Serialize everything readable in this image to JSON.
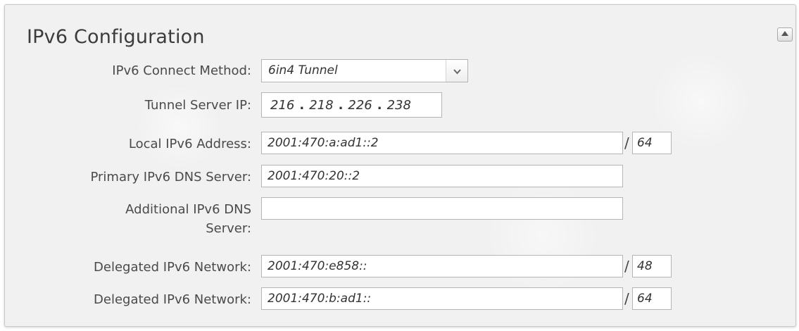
{
  "panel": {
    "title": "IPv6 Configuration"
  },
  "fields": {
    "connect_method": {
      "label": "IPv6 Connect Method:",
      "value": "6in4 Tunnel"
    },
    "tunnel_server": {
      "label": "Tunnel Server IP:",
      "octets": [
        "216",
        "218",
        "226",
        "238"
      ],
      "separator": "."
    },
    "local_address": {
      "label": "Local IPv6 Address:",
      "value": "2001:470:a:ad1::2",
      "prefix": "64"
    },
    "primary_dns": {
      "label": "Primary IPv6 DNS Server:",
      "value": "2001:470:20::2"
    },
    "additional_dns": {
      "label_line1": "Additional IPv6 DNS",
      "label_line2": "Server:",
      "value": ""
    },
    "delegated_1": {
      "label": "Delegated IPv6 Network:",
      "value": "2001:470:e858::",
      "prefix": "48"
    },
    "delegated_2": {
      "label": "Delegated IPv6 Network:",
      "value": "2001:470:b:ad1::",
      "prefix": "64"
    },
    "prefix_separator": "/"
  },
  "icons": {
    "collapse": "collapse-up-icon",
    "dropdown": "chevron-down-icon"
  },
  "colors": {
    "panel_bg": "#f1f1f1",
    "border": "#b5b5b5",
    "label_text": "#4a4a4a"
  }
}
